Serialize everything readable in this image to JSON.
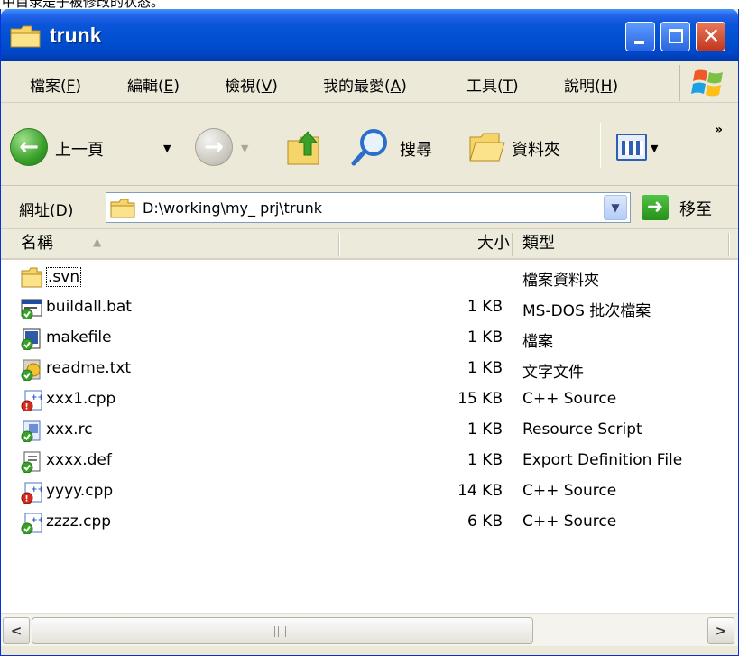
{
  "caption_fragment": "中目录是子被修改的状态。",
  "window": {
    "title": "trunk",
    "close_glyph": "✕"
  },
  "menu": {
    "items": [
      {
        "label": "檔案",
        "key": "F"
      },
      {
        "label": "編輯",
        "key": "E"
      },
      {
        "label": "檢視",
        "key": "V"
      },
      {
        "label": "我的最愛",
        "key": "A"
      },
      {
        "label": "工具",
        "key": "T"
      },
      {
        "label": "說明",
        "key": "H"
      }
    ]
  },
  "toolbar": {
    "back_label": "上一頁",
    "search_label": "搜尋",
    "folders_label": "資料夾",
    "overflow": "»"
  },
  "address": {
    "label": "網址",
    "key": "D",
    "path": "D:\\working\\my_ prj\\trunk",
    "go_label": "移至"
  },
  "columns": {
    "name": "名稱",
    "size": "大小",
    "type": "類型"
  },
  "files": [
    {
      "name": ".svn",
      "size": "",
      "type": "檔案資料夾",
      "icon": "folder-icon"
    },
    {
      "name": "buildall.bat",
      "size": "1 KB",
      "type": "MS-DOS 批次檔案",
      "icon": "batch-file-icon"
    },
    {
      "name": "makefile",
      "size": "1 KB",
      "type": "檔案",
      "icon": "generic-file-icon"
    },
    {
      "name": "readme.txt",
      "size": "1 KB",
      "type": "文字文件",
      "icon": "text-file-icon"
    },
    {
      "name": "xxx1.cpp",
      "size": "15 KB",
      "type": "C++ Source",
      "icon": "cpp-file-modified-icon"
    },
    {
      "name": "xxx.rc",
      "size": "1 KB",
      "type": "Resource Script",
      "icon": "resource-file-icon"
    },
    {
      "name": "xxxx.def",
      "size": "1 KB",
      "type": "Export Definition File",
      "icon": "def-file-icon"
    },
    {
      "name": "yyyy.cpp",
      "size": "14 KB",
      "type": "C++ Source",
      "icon": "cpp-file-modified-icon"
    },
    {
      "name": "zzzz.cpp",
      "size": "6 KB",
      "type": "C++ Source",
      "icon": "cpp-file-icon"
    }
  ],
  "scrollbar": {
    "left_glyph": "<",
    "right_glyph": ">"
  },
  "colors": {
    "titlebar": "#0050d0",
    "close_button": "#c2371d",
    "window_frame": "#ece9d8"
  }
}
